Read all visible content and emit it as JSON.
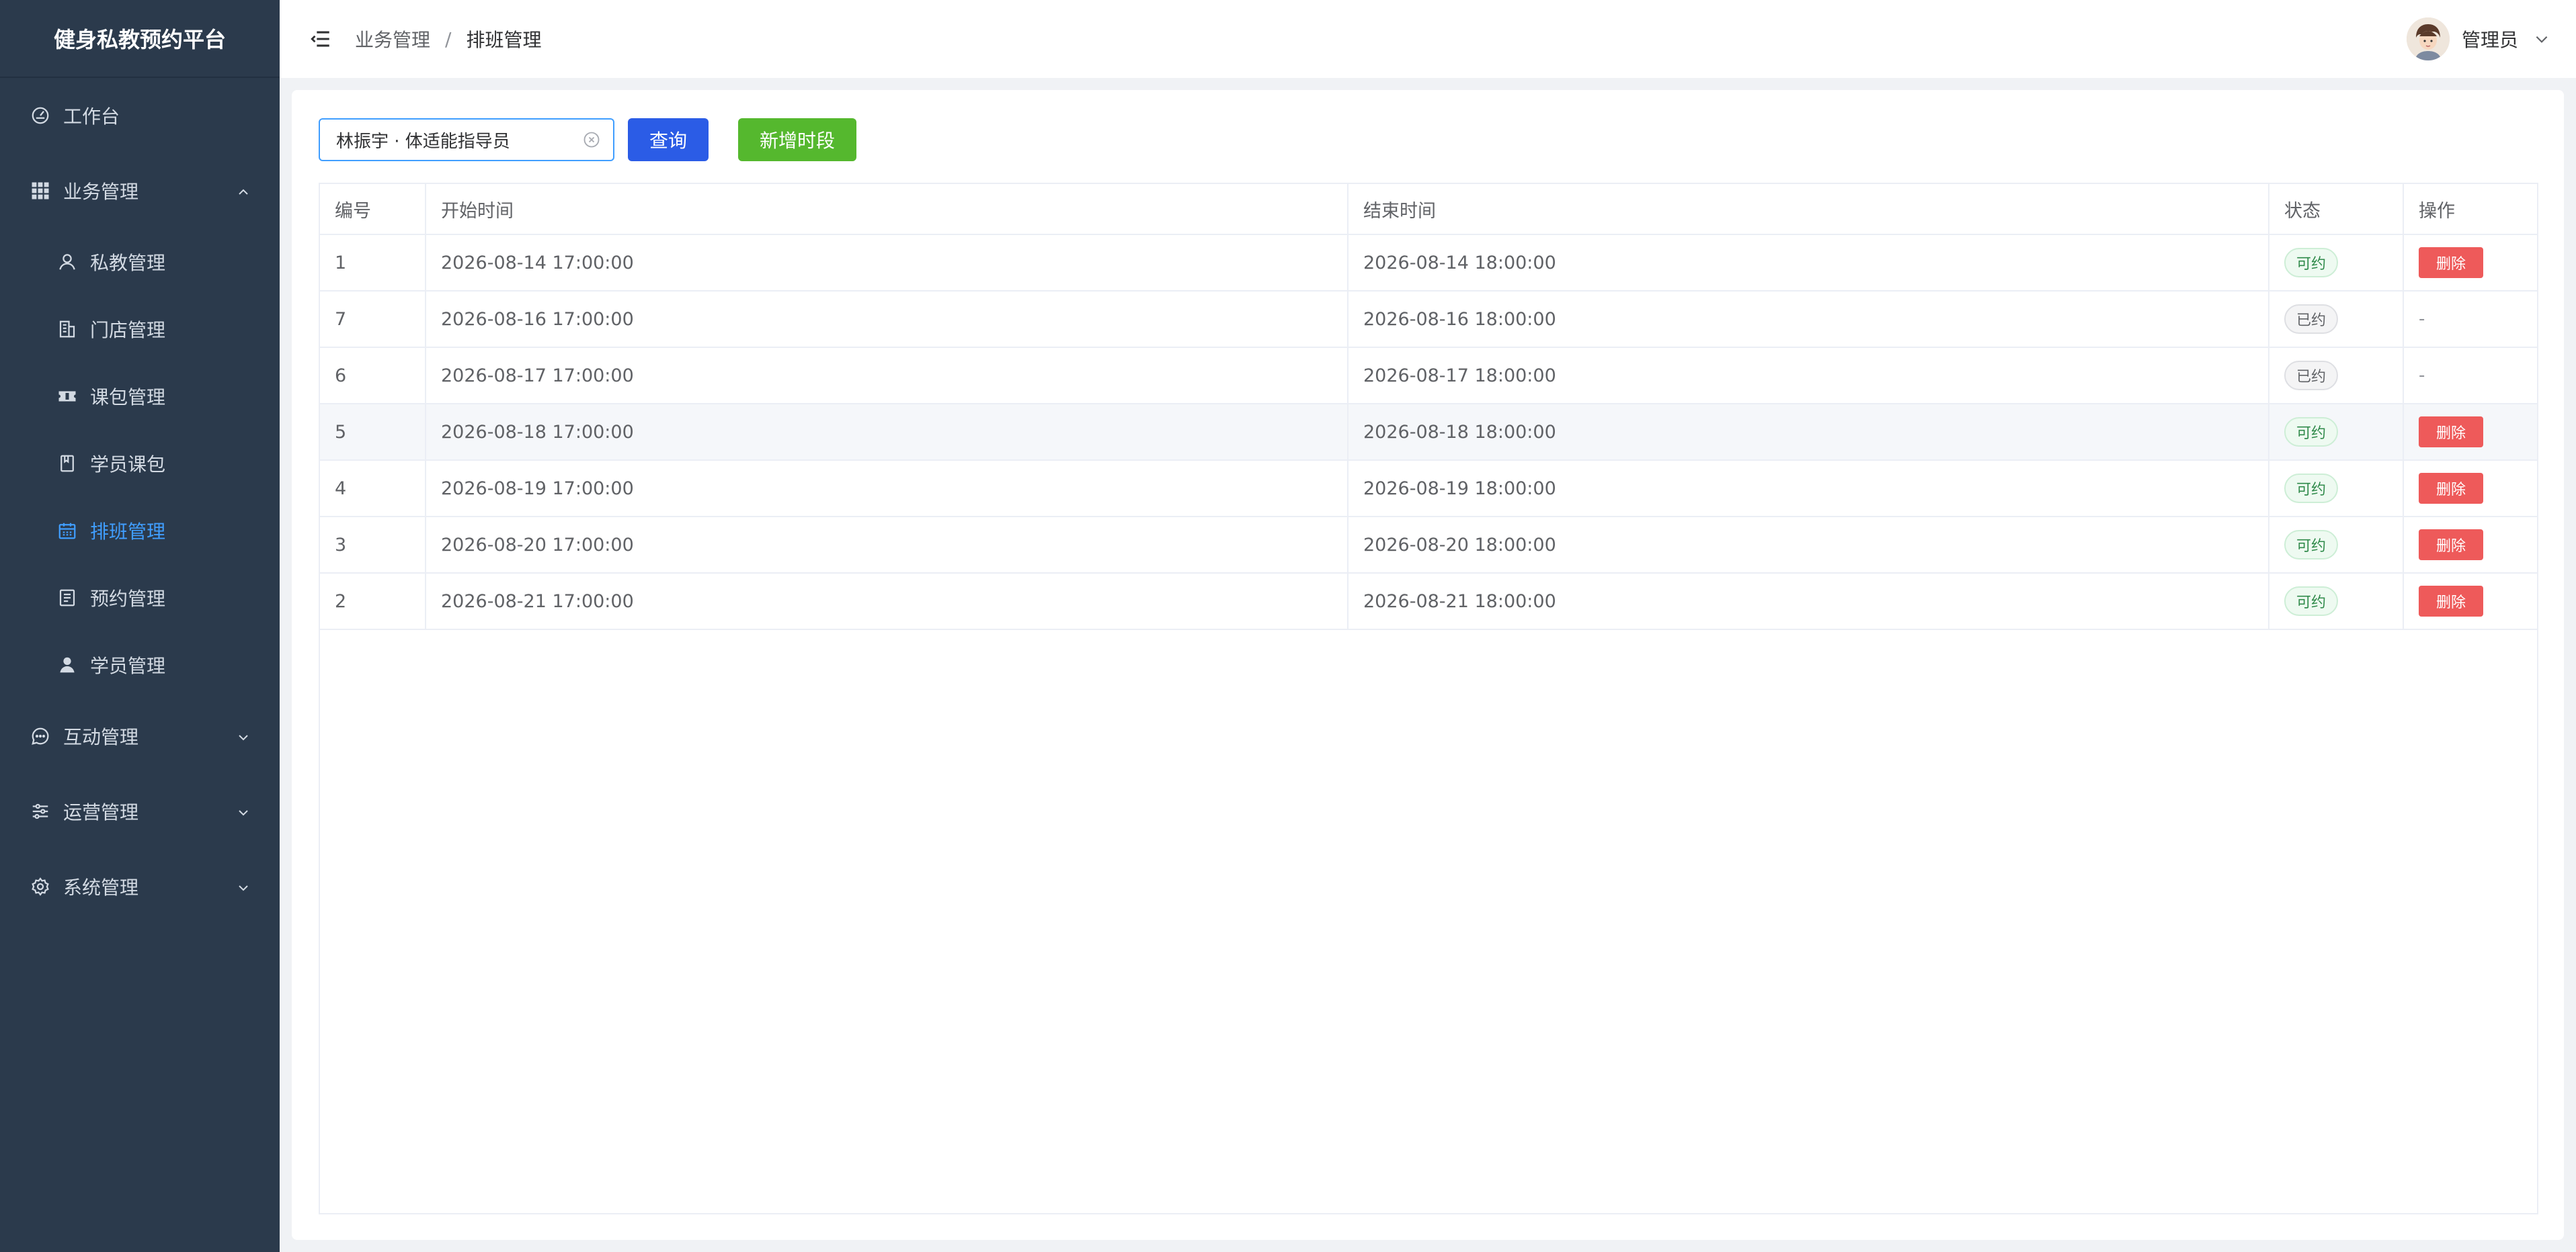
{
  "app": {
    "brand": "健身私教预约平台"
  },
  "sidebar": {
    "items": [
      {
        "label": "工作台",
        "icon": "dashboard-gauge-icon"
      },
      {
        "label": "业务管理",
        "icon": "grid-icon",
        "expanded": true
      },
      {
        "label": "私教管理",
        "icon": "user-icon"
      },
      {
        "label": "门店管理",
        "icon": "building-icon"
      },
      {
        "label": "课包管理",
        "icon": "ticket-icon"
      },
      {
        "label": "学员课包",
        "icon": "notebook-icon"
      },
      {
        "label": "排班管理",
        "icon": "calendar-icon",
        "active": true
      },
      {
        "label": "预约管理",
        "icon": "document-icon"
      },
      {
        "label": "学员管理",
        "icon": "user-filled-icon"
      },
      {
        "label": "互动管理",
        "icon": "chat-icon"
      },
      {
        "label": "运营管理",
        "icon": "sliders-icon"
      },
      {
        "label": "系统管理",
        "icon": "gear-icon"
      }
    ]
  },
  "header": {
    "breadcrumb": [
      "业务管理",
      "排班管理"
    ],
    "separator": "/",
    "user_name": "管理员"
  },
  "toolbar": {
    "search_value": "林振宇 · 体适能指导员",
    "query_label": "查询",
    "add_label": "新增时段"
  },
  "table": {
    "headers": [
      "编号",
      "开始时间",
      "结束时间",
      "状态",
      "操作"
    ],
    "rows": [
      {
        "id": "1",
        "start": "2026-08-14 17:00:00",
        "end": "2026-08-14 18:00:00",
        "status": "可约",
        "action": "删除"
      },
      {
        "id": "7",
        "start": "2026-08-16 17:00:00",
        "end": "2026-08-16 18:00:00",
        "status": "已约",
        "action": "-"
      },
      {
        "id": "6",
        "start": "2026-08-17 17:00:00",
        "end": "2026-08-17 18:00:00",
        "status": "已约",
        "action": "-"
      },
      {
        "id": "5",
        "start": "2026-08-18 17:00:00",
        "end": "2026-08-18 18:00:00",
        "status": "可约",
        "action": "删除"
      },
      {
        "id": "4",
        "start": "2026-08-19 17:00:00",
        "end": "2026-08-19 18:00:00",
        "status": "可约",
        "action": "删除"
      },
      {
        "id": "3",
        "start": "2026-08-20 17:00:00",
        "end": "2026-08-20 18:00:00",
        "status": "可约",
        "action": "删除"
      },
      {
        "id": "2",
        "start": "2026-08-21 17:00:00",
        "end": "2026-08-21 18:00:00",
        "status": "可约",
        "action": "删除"
      }
    ]
  },
  "colors": {
    "sidebar_bg": "#2b3a4c",
    "active": "#409eff",
    "query_button": "#2b5ce6",
    "add_button": "#55b82e",
    "delete_button": "#ee5a5a"
  }
}
